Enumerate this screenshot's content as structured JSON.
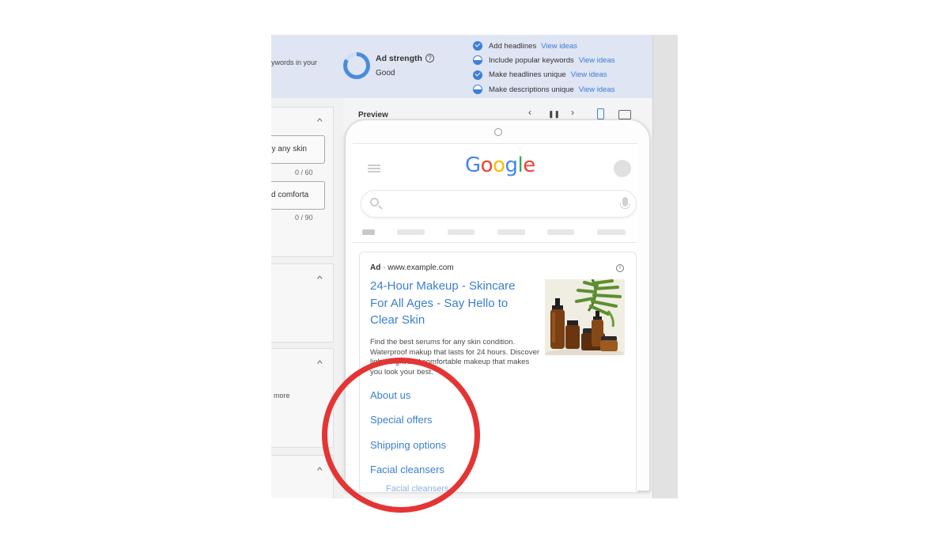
{
  "banner": {
    "cut_text": "ywords in your",
    "ad_strength_label": "Ad strength",
    "help_icon": "?",
    "ad_strength_value": "Good",
    "tips": [
      {
        "text": "Add headlines",
        "link": "View ideas",
        "status": "done"
      },
      {
        "text": "Include popular keywords",
        "link": "View ideas",
        "status": "partial"
      },
      {
        "text": "Make headlines unique",
        "link": "View ideas",
        "status": "done"
      },
      {
        "text": "Make descriptions unique",
        "link": "View ideas",
        "status": "partial"
      }
    ]
  },
  "left_panel": {
    "field_1_value": "y any skin",
    "field_1_count": "0 / 60",
    "field_2_value": "d comforta",
    "field_2_count": "0 / 90",
    "more_text": "more",
    "caret": "^"
  },
  "preview": {
    "title": "Preview",
    "prev": "‹",
    "pause": "❚❚",
    "next": "›"
  },
  "search": {
    "logo_letters": [
      {
        "char": "G",
        "color": "#4285F4"
      },
      {
        "char": "o",
        "color": "#EA4335"
      },
      {
        "char": "o",
        "color": "#FBBC05"
      },
      {
        "char": "g",
        "color": "#4285F4"
      },
      {
        "char": "l",
        "color": "#34A853"
      },
      {
        "char": "e",
        "color": "#EA4335"
      }
    ]
  },
  "ad": {
    "label": "Ad",
    "separator": " · ",
    "url": "www.example.com",
    "info_icon": "i",
    "headline": "24-Hour Makeup - Skincare For All Ages  -  Say Hello to Clear Skin",
    "description": "Find the best serums for any skin condition. Waterproof makup that lasts for 24 hours. Discover lightweight and comfortable makeup that makes you look your best.",
    "sitelinks": [
      "About us",
      "Special offers",
      "Shipping options",
      "Facial cleansers"
    ],
    "partial_sitelink": "Facial cleansers"
  },
  "colors": {
    "accent_blue": "#3a7fd0",
    "annotation_red": "#e53434",
    "banner_bg": "#dfe5f3"
  }
}
